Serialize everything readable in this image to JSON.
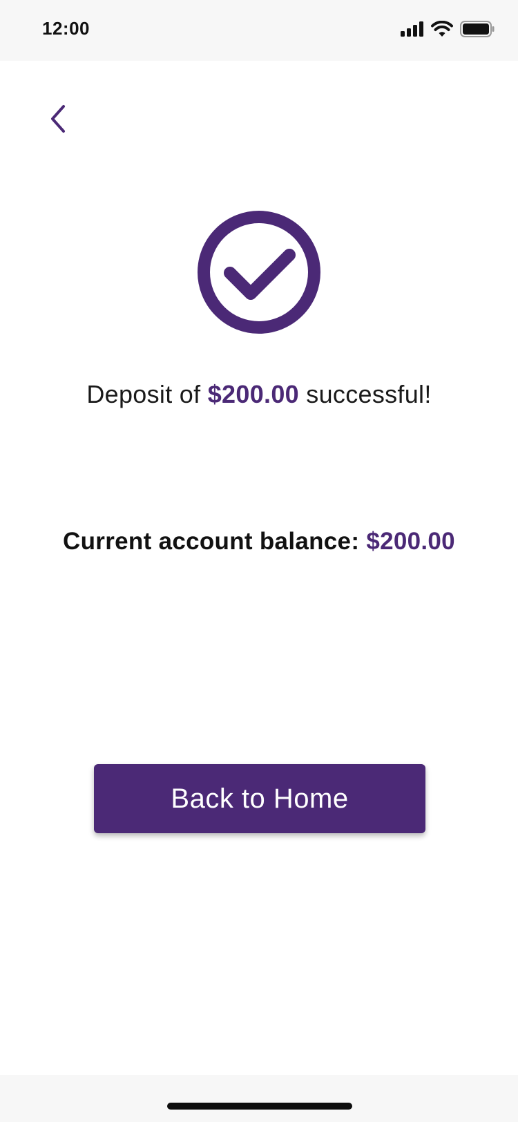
{
  "status_bar": {
    "time": "12:00",
    "icons": [
      "signal-icon",
      "wifi-icon",
      "battery-icon"
    ]
  },
  "navigation": {
    "back_icon": "chevron-left-icon"
  },
  "success": {
    "icon": "check-circle-icon",
    "message_prefix": "Deposit of ",
    "message_amount": "$200.00",
    "message_suffix": " successful!"
  },
  "balance": {
    "label": "Current account balance: ",
    "amount": "$200.00"
  },
  "actions": {
    "home_button_label": "Back to Home"
  },
  "colors": {
    "accent": "#4b2976",
    "text": "#1a1a1a",
    "status_bar_bg": "#f7f7f7",
    "button_text": "#ffffff"
  }
}
